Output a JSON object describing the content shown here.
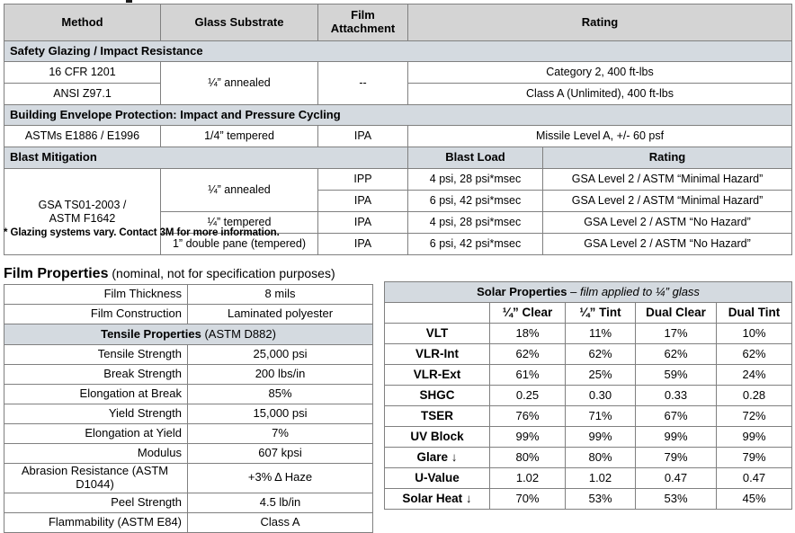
{
  "performance_table": {
    "columns": [
      "Method",
      "Glass Substrate",
      "Film Attachment",
      "Rating"
    ],
    "sections": [
      {
        "band": "Safety Glazing / Impact Resistance",
        "rows": [
          {
            "method": "16 CFR 1201",
            "substrate": "¼” annealed",
            "attachment": "--",
            "rating": "Category 2, 400 ft-lbs"
          },
          {
            "method": "ANSI Z97.1",
            "rating": "Class A (Unlimited), 400 ft-lbs"
          }
        ]
      },
      {
        "band": "Building Envelope Protection:  Impact and Pressure Cycling",
        "rows": [
          {
            "method": "ASTMs E1886 / E1996",
            "substrate": "1/4” tempered",
            "attachment": "IPA",
            "rating": "Missile Level A, +/- 60 psf"
          }
        ]
      },
      {
        "band": "Blast Mitigation",
        "band_col_blast_load": "Blast Load",
        "band_col_rating": "Rating",
        "method": "GSA TS01-2003  /\nASTM F1642",
        "rows": [
          {
            "substrate": "¼” annealed",
            "attachment": "IPP",
            "blast_load": "4 psi, 28 psi*msec",
            "rating": "GSA Level 2 / ASTM “Minimal Hazard”"
          },
          {
            "attachment": "IPA",
            "blast_load": "6 psi, 42 psi*msec",
            "rating": "GSA Level 2 / ASTM “Minimal Hazard”"
          },
          {
            "substrate": "¼” tempered",
            "attachment": "IPA",
            "blast_load": "4 psi, 28 psi*msec",
            "rating": "GSA Level 2 / ASTM “No Hazard”"
          },
          {
            "substrate": "1” double pane (tempered)",
            "attachment": "IPA",
            "blast_load": "6 psi, 42 psi*msec",
            "rating": "GSA Level 2 / ASTM “No Hazard”"
          }
        ]
      }
    ]
  },
  "footnote": "* Glazing systems vary.  Contact 3M for more information.",
  "film_properties": {
    "heading_title": "Film Properties",
    "heading_sub": " (nominal, not for specification purposes)",
    "rows_top": [
      {
        "label": "Film Thickness",
        "value": "8 mils"
      },
      {
        "label": "Film Construction",
        "value": "Laminated polyester"
      }
    ],
    "band_bold": "Tensile Properties",
    "band_normal": " (ASTM D882)",
    "rows_tensile": [
      {
        "label": "Tensile Strength",
        "value": "25,000 psi"
      },
      {
        "label": "Break Strength",
        "value": "200 lbs/in"
      },
      {
        "label": "Elongation at Break",
        "value": "85%"
      },
      {
        "label": "Yield Strength",
        "value": "15,000 psi"
      },
      {
        "label": "Elongation at Yield",
        "value": "7%"
      },
      {
        "label": "Modulus",
        "value": "607 kpsi"
      }
    ],
    "rows_bottom": [
      {
        "label": "Abrasion Resistance (ASTM D1044)",
        "value": "+3% Δ Haze"
      },
      {
        "label": "Peel Strength",
        "value": "4.5 lb/in"
      },
      {
        "label": "Flammability (ASTM E84)",
        "value": "Class A"
      }
    ]
  },
  "solar_properties": {
    "title_bold": "Solar Properties",
    "title_italic": " – film applied to ¼” glass",
    "columns": [
      "",
      "¼” Clear",
      "¼” Tint",
      "Dual Clear",
      "Dual Tint"
    ],
    "rows": [
      {
        "label": "VLT",
        "values": [
          "18%",
          "11%",
          "17%",
          "10%"
        ]
      },
      {
        "label": "VLR-Int",
        "values": [
          "62%",
          "62%",
          "62%",
          "62%"
        ]
      },
      {
        "label": "VLR-Ext",
        "values": [
          "61%",
          "25%",
          "59%",
          "24%"
        ]
      },
      {
        "label": "SHGC",
        "values": [
          "0.25",
          "0.30",
          "0.33",
          "0.28"
        ]
      },
      {
        "label": "TSER",
        "values": [
          "76%",
          "71%",
          "67%",
          "72%"
        ]
      },
      {
        "label": "UV Block",
        "values": [
          "99%",
          "99%",
          "99%",
          "99%"
        ]
      },
      {
        "label": "Glare ↓",
        "values": [
          "80%",
          "80%",
          "79%",
          "79%"
        ]
      },
      {
        "label": "U-Value",
        "values": [
          "1.02",
          "1.02",
          "0.47",
          "0.47"
        ]
      },
      {
        "label": "Solar Heat ↓",
        "values": [
          "70%",
          "53%",
          "53%",
          "45%"
        ]
      }
    ]
  },
  "colors": {
    "header_gray": "#d4d4d4",
    "section_band": "#d4dae0",
    "grid_line": "#808080",
    "outer_border": "#000000"
  }
}
